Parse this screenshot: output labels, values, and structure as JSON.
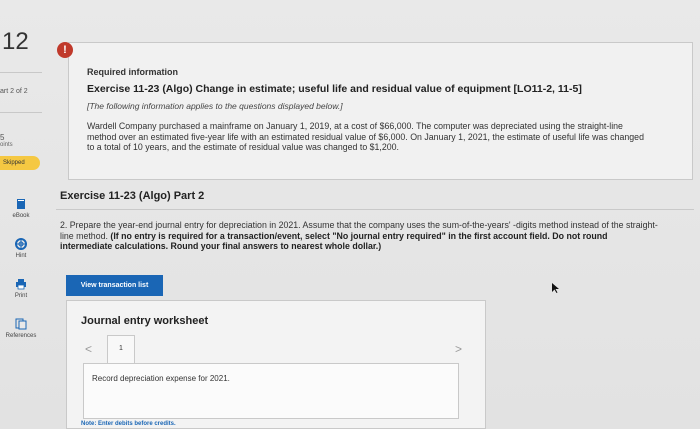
{
  "sidebar": {
    "question_number": "12",
    "part_of": "art 2 of 2",
    "points_value": "5",
    "points_label": "oints",
    "skipped_label": "Skipped",
    "tools": {
      "ebook": "eBook",
      "hint": "Hint",
      "print": "Print",
      "references": "References"
    }
  },
  "alert": {
    "symbol": "!"
  },
  "info": {
    "required_title": "Required information",
    "exercise_title": "Exercise 11-23 (Algo) Change in estimate; useful life and residual value of equipment [LO11-2, 11-5]",
    "note": "[The following information applies to the questions displayed below.]",
    "description": "Wardell Company purchased a mainframe on January 1, 2019, at a cost of $66,000. The computer was depreciated using the straight-line method over an estimated five-year life with an estimated residual value of $6,000. On January 1, 2021, the estimate of useful life was changed to a total of 10 years, and the estimate of residual value was changed to $1,200."
  },
  "part": {
    "title": "Exercise 11-23 (Algo) Part 2",
    "question_plain": "2. Prepare the year-end journal entry for depreciation in 2021. Assume that the company uses the sum-of-the-years' -digits method instead of the straight-line method.",
    "question_bold": "(If no entry is required for a transaction/event, select \"No journal entry required\" in the first account field. Do not round intermediate calculations. Round your final answers to nearest whole dollar.)"
  },
  "buttons": {
    "view_transaction_list": "View transaction list"
  },
  "worksheet": {
    "title": "Journal entry worksheet",
    "left_arrow": "<",
    "right_arrow": ">",
    "tab_label": "1",
    "entry_text": "Record depreciation expense for 2021.",
    "note": "Note: Enter debits before credits."
  },
  "colors": {
    "accent": "#1a66b5",
    "alert": "#c0392b",
    "skipped": "#f5c842"
  }
}
